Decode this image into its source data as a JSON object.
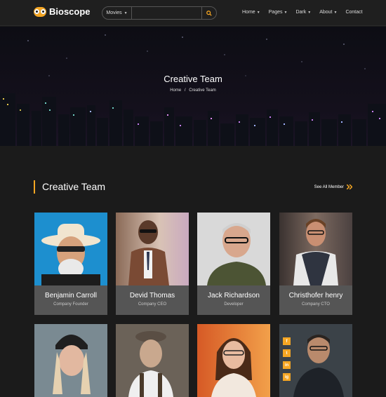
{
  "brand": {
    "name": "Bioscope",
    "logo_icon": "binoculars-icon"
  },
  "search": {
    "category": "Movies",
    "placeholder": "",
    "button_icon": "search-icon"
  },
  "nav": [
    {
      "label": "Home",
      "dropdown": true
    },
    {
      "label": "Pages",
      "dropdown": true
    },
    {
      "label": "Dark",
      "dropdown": true
    },
    {
      "label": "About",
      "dropdown": true
    },
    {
      "label": "Contact",
      "dropdown": false
    }
  ],
  "hero": {
    "title": "Creative Team",
    "breadcrumb": {
      "home": "Home",
      "separator": "/",
      "current": "Creative Team"
    }
  },
  "section": {
    "title": "Creative Team",
    "see_all": "See All Member",
    "accent_color": "#f5a623"
  },
  "team": [
    {
      "name": "Benjamin Carroll",
      "role": "Company Founder"
    },
    {
      "name": "Devid Thomas",
      "role": "Company CEO"
    },
    {
      "name": "Jack Richardson",
      "role": "Developer"
    },
    {
      "name": "Christhofer henry",
      "role": "Company CTO"
    }
  ],
  "socials": [
    "f",
    "t",
    "in",
    "ig"
  ],
  "colors": {
    "accent": "#f5a623",
    "background": "#1b1b1b",
    "card_info": "#555555"
  }
}
